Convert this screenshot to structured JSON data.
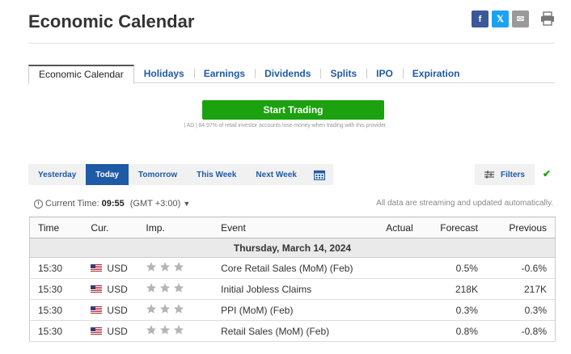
{
  "page": {
    "title": "Economic Calendar"
  },
  "share": {
    "facebook": "f",
    "twitter": "𝕏",
    "email": "✉"
  },
  "tabs": [
    "Economic Calendar",
    "Holidays",
    "Earnings",
    "Dividends",
    "Splits",
    "IPO",
    "Expiration"
  ],
  "ad": {
    "cta_label": "Start Trading",
    "disclaimer": "| AD | 84.97% of retail investor accounts lose money when trading with this provider."
  },
  "date_filters": [
    "Yesterday",
    "Today",
    "Tomorrow",
    "This Week",
    "Next Week"
  ],
  "filters_label": "Filters",
  "time_bar": {
    "label": "Current Time:",
    "time": "09:55",
    "timezone": "(GMT +3:00)"
  },
  "stream_note": "All data are streaming and updated automatically.",
  "table": {
    "headers": [
      "Time",
      "Cur.",
      "Imp.",
      "Event",
      "Actual",
      "Forecast",
      "Previous"
    ],
    "date_label": "Thursday, March 14, 2024",
    "rows": [
      {
        "time": "15:30",
        "currency": "USD",
        "event": "Core Retail Sales (MoM) (Feb)",
        "actual": "",
        "forecast": "0.5%",
        "previous": "-0.6%"
      },
      {
        "time": "15:30",
        "currency": "USD",
        "event": "Initial Jobless Claims",
        "actual": "",
        "forecast": "218K",
        "previous": "217K"
      },
      {
        "time": "15:30",
        "currency": "USD",
        "event": "PPI (MoM) (Feb)",
        "actual": "",
        "forecast": "0.3%",
        "previous": "0.3%"
      },
      {
        "time": "15:30",
        "currency": "USD",
        "event": "Retail Sales (MoM) (Feb)",
        "actual": "",
        "forecast": "0.8%",
        "previous": "-0.8%"
      }
    ]
  },
  "colors": {
    "accent": "#1f5aa6",
    "cta": "#1ca10f",
    "star": "#b5b5b5"
  }
}
